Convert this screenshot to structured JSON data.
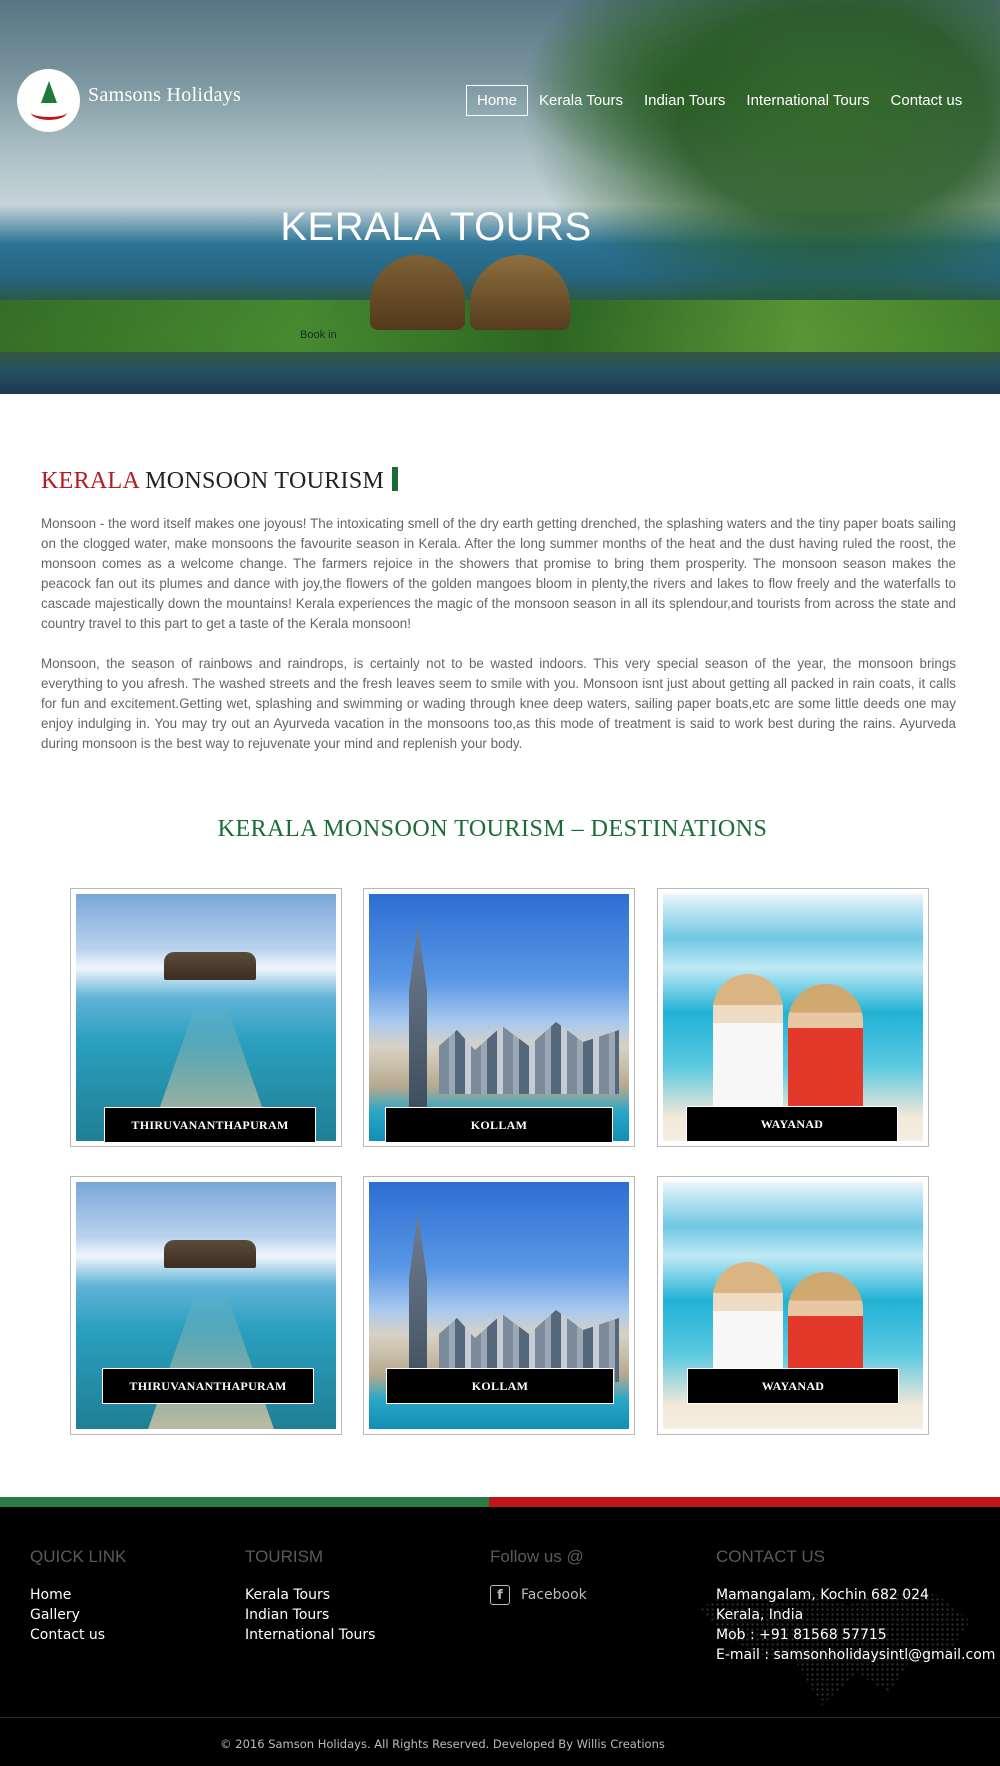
{
  "header": {
    "brand": "Samsons Holidays",
    "nav": [
      "Home",
      "Kerala Tours",
      "Indian Tours",
      "International Tours",
      "Contact us"
    ],
    "active_nav": "Home"
  },
  "hero": {
    "title": "KERALA TOURS",
    "subtitle": "Book in"
  },
  "intro": {
    "title_red": "KERALA",
    "title_rest": " MONSOON TOURISM",
    "para1": "Monsoon - the word itself makes one joyous! The intoxicating smell of the dry earth getting drenched, the splashing waters and the tiny paper boats sailing on the clogged water, make monsoons the favourite season in Kerala. After the long summer months of the heat and the dust having ruled the roost, the monsoon comes as a welcome change. The farmers rejoice in the showers that promise to bring them prosperity. The monsoon season makes the peacock fan out its plumes and dance with joy,the flowers of the golden mangoes bloom in plenty,the rivers and lakes to flow freely and the waterfalls to cascade majestically down the mountains! Kerala experiences the magic of the monsoon season in all its splendour,and tourists from across the state and country travel to this part to get a taste of the Kerala monsoon!",
    "para2": "Monsoon, the season of rainbows and raindrops, is certainly not to be wasted indoors. This very special season of the year, the monsoon brings everything to you afresh. The washed streets and the fresh leaves seem to smile with you. Monsoon isnt just about getting all packed in rain coats, it calls for fun and excitement.Getting wet, splashing and swimming or wading through knee deep waters, sailing paper boats,etc are some little deeds one may enjoy indulging in. You may try out an Ayurveda vacation in the monsoons too,as this mode of treatment is said to work best during the rains. Ayurveda during monsoon is the best way to rejuvenate your mind and replenish your body."
  },
  "destinations": {
    "title": "KERALA MONSOON TOURISM – DESTINATIONS",
    "cards": [
      {
        "label": "THIRUVANANTHAPURAM"
      },
      {
        "label": "KOLLAM"
      },
      {
        "label": "WAYANAD"
      },
      {
        "label": "THIRUVANANTHAPURAM"
      },
      {
        "label": "KOLLAM"
      },
      {
        "label": "WAYANAD"
      }
    ]
  },
  "footer": {
    "quick_link": {
      "title": "QUICK LINK",
      "links": [
        "Home",
        "Gallery",
        "Contact us"
      ]
    },
    "tourism": {
      "title": "TOURISM",
      "links": [
        "Kerala Tours",
        "Indian Tours",
        "International Tours"
      ]
    },
    "follow": {
      "title": "Follow us @",
      "facebook": "Facebook",
      "icon": "facebook-icon"
    },
    "contact": {
      "title": "CONTACT US",
      "lines": [
        "Mamangalam, Kochin 682 024",
        "Kerala, India",
        "Mob : +91 81568 57715",
        "E-mail : samsonholidaysintl@gmail.com"
      ]
    },
    "copyright": "© 2016 Samson Holidays. All Rights Reserved. Developed By Willis Creations"
  },
  "colors": {
    "accent_red": "#b51a1f",
    "accent_green": "#1b6b35",
    "footer_bg": "#000000"
  }
}
